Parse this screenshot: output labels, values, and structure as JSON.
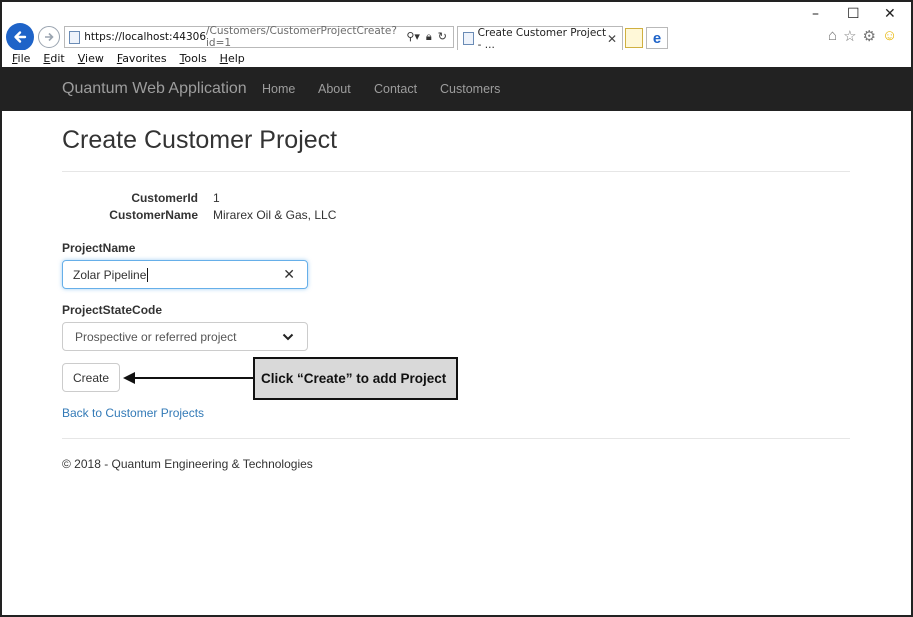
{
  "browser": {
    "url_host": "https://localhost:",
    "url_port": "44306",
    "url_path": "/Customers/CustomerProjectCreate?id=1",
    "tab_title": "Create Customer Project - ...",
    "menu": [
      "File",
      "Edit",
      "View",
      "Favorites",
      "Tools",
      "Help"
    ]
  },
  "site": {
    "brand": "Quantum Web Application",
    "nav": [
      "Home",
      "About",
      "Contact",
      "Customers"
    ]
  },
  "page": {
    "title": "Create Customer Project",
    "details": [
      {
        "label": "CustomerId",
        "value": "1"
      },
      {
        "label": "CustomerName",
        "value": "Mirarex Oil & Gas, LLC"
      }
    ],
    "project_name_label": "ProjectName",
    "project_name_value": "Zolar Pipeline",
    "project_state_label": "ProjectStateCode",
    "project_state_value": "Prospective or referred project",
    "create_button": "Create",
    "callout": "Click “Create” to add Project",
    "back_link": "Back to Customer Projects",
    "footer": "© 2018 - Quantum Engineering & Technologies"
  },
  "colors": {
    "navbar": "#222222",
    "link": "#337ab7",
    "ie_blue": "#1e63c8"
  }
}
